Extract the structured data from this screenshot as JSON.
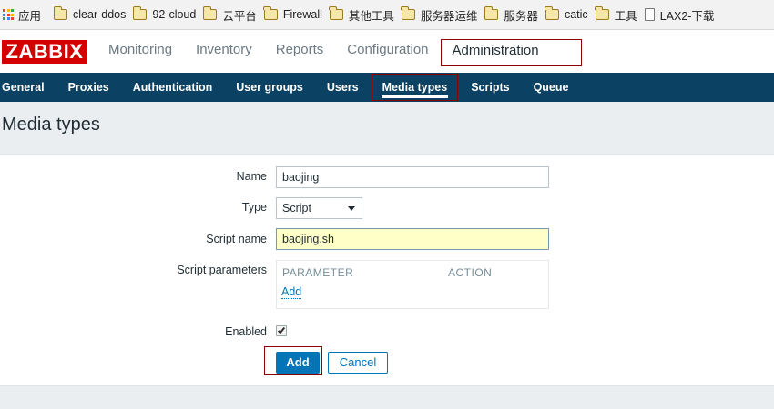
{
  "bookmarks": {
    "apps_label": "应用",
    "items": [
      {
        "label": "clear-ddos",
        "icon": "folder-icon"
      },
      {
        "label": "92-cloud",
        "icon": "folder-icon"
      },
      {
        "label": "云平台",
        "icon": "folder-icon"
      },
      {
        "label": "Firewall",
        "icon": "folder-icon"
      },
      {
        "label": "其他工具",
        "icon": "folder-icon"
      },
      {
        "label": "服务器运维",
        "icon": "folder-icon"
      },
      {
        "label": "服务器",
        "icon": "folder-icon"
      },
      {
        "label": "catic",
        "icon": "folder-icon"
      },
      {
        "label": "工具",
        "icon": "folder-icon"
      },
      {
        "label": "LAX2-下载",
        "icon": "page-icon"
      }
    ]
  },
  "header": {
    "logo": "ZABBIX",
    "nav": [
      "Monitoring",
      "Inventory",
      "Reports",
      "Configuration",
      "Administration"
    ],
    "active": "Administration"
  },
  "subnav": {
    "items": [
      "General",
      "Proxies",
      "Authentication",
      "User groups",
      "Users",
      "Media types",
      "Scripts",
      "Queue"
    ],
    "active": "Media types"
  },
  "page": {
    "title": "Media types"
  },
  "form": {
    "name_label": "Name",
    "name_value": "baojing",
    "type_label": "Type",
    "type_value": "Script",
    "script_name_label": "Script name",
    "script_name_value": "baojing.sh",
    "script_params_label": "Script parameters",
    "params_header_parameter": "PARAMETER",
    "params_header_action": "ACTION",
    "params_add_link": "Add",
    "enabled_label": "Enabled",
    "enabled_checked": true,
    "add_button": "Add",
    "cancel_button": "Cancel"
  },
  "colors": {
    "brand_red": "#d40000",
    "subnav_bg": "#0b4163",
    "primary": "#0275b8",
    "highlight_outline": "#8b0000"
  }
}
